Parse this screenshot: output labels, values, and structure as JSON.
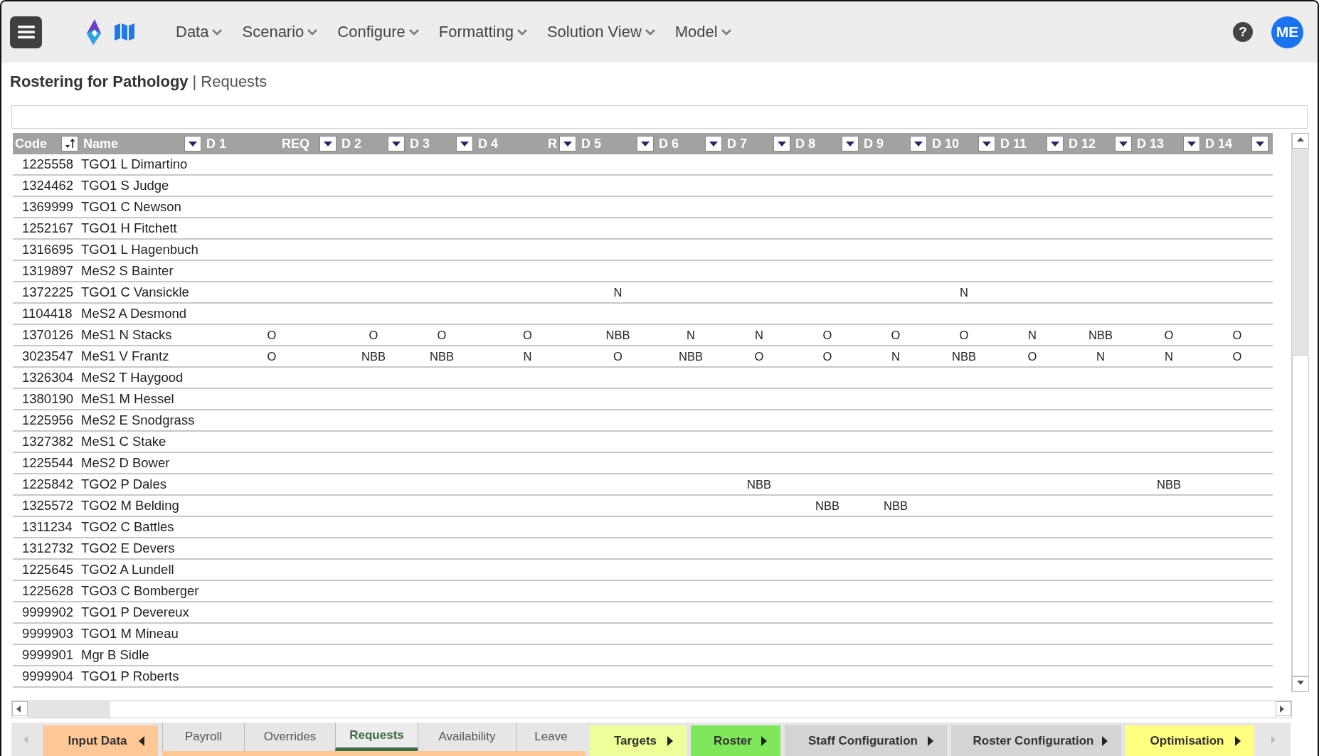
{
  "menu": [
    "Data",
    "Scenario",
    "Configure",
    "Formatting",
    "Solution View",
    "Model"
  ],
  "help": {
    "symbol": "?"
  },
  "user": {
    "initials": "ME"
  },
  "title": {
    "app": "Rostering for Pathology",
    "separator": "|",
    "page": "Requests"
  },
  "columns": [
    {
      "label": "Code",
      "kind": "sort"
    },
    {
      "label": "Name",
      "kind": "filter"
    },
    {
      "label": "D 1",
      "kind": "plain"
    },
    {
      "label": "REQ",
      "kind": "filter"
    },
    {
      "label": "D 2",
      "kind": "filter"
    },
    {
      "label": "D 3",
      "kind": "filter"
    },
    {
      "label": "D 4",
      "kind": "plain"
    },
    {
      "label": "R",
      "kind": "filter"
    },
    {
      "label": "D 5",
      "kind": "filter"
    },
    {
      "label": "D 6",
      "kind": "filter"
    },
    {
      "label": "D 7",
      "kind": "filter"
    },
    {
      "label": "D 8",
      "kind": "filter"
    },
    {
      "label": "D 9",
      "kind": "filter"
    },
    {
      "label": "D 10",
      "kind": "filter"
    },
    {
      "label": "D 11",
      "kind": "filter"
    },
    {
      "label": "D 12",
      "kind": "filter"
    },
    {
      "label": "D 13",
      "kind": "filter"
    },
    {
      "label": "D 14",
      "kind": "filter"
    }
  ],
  "rows": [
    {
      "code": "1225558",
      "name": "TGO1 L Dimartino",
      "days": {}
    },
    {
      "code": "1324462",
      "name": "TGO1 S Judge",
      "days": {}
    },
    {
      "code": "1369999",
      "name": "TGO1 C Newson",
      "days": {}
    },
    {
      "code": "1252167",
      "name": "TGO1 H Fitchett",
      "days": {}
    },
    {
      "code": "1316695",
      "name": "TGO1 L Hagenbuch",
      "days": {}
    },
    {
      "code": "1319897",
      "name": "MeS2 S Bainter",
      "days": {}
    },
    {
      "code": "1372225",
      "name": "TGO1 C Vansickle",
      "days": {
        "d5": "N",
        "d10": "N"
      }
    },
    {
      "code": "1104418",
      "name": "MeS2 A Desmond",
      "days": {}
    },
    {
      "code": "1370126",
      "name": "MeS1 N Stacks",
      "days": {
        "d1": "O",
        "d2": "O",
        "d3": "O",
        "d4": "O",
        "d5": "NBB",
        "d6": "N",
        "d7": "N",
        "d8": "O",
        "d9": "O",
        "d10": "O",
        "d11": "N",
        "d12": "NBB",
        "d13": "O",
        "d14": "O"
      }
    },
    {
      "code": "3023547",
      "name": "MeS1 V Frantz",
      "days": {
        "d1": "O",
        "d2": "NBB",
        "d3": "NBB",
        "d4": "N",
        "d5": "O",
        "d6": "NBB",
        "d7": "O",
        "d8": "O",
        "d9": "N",
        "d10": "NBB",
        "d11": "O",
        "d12": "N",
        "d13": "N",
        "d14": "O"
      }
    },
    {
      "code": "1326304",
      "name": "MeS2 T Haygood",
      "days": {}
    },
    {
      "code": "1380190",
      "name": "MeS1 M Hessel",
      "days": {}
    },
    {
      "code": "1225956",
      "name": "MeS2 E Snodgrass",
      "days": {}
    },
    {
      "code": "1327382",
      "name": "MeS1 C Stake",
      "days": {}
    },
    {
      "code": "1225544",
      "name": "MeS2 D Bower",
      "days": {}
    },
    {
      "code": "1225842",
      "name": "TGO2 P Dales",
      "days": {
        "d7": "NBB",
        "d13": "NBB"
      }
    },
    {
      "code": "1325572",
      "name": "TGO2 M Belding",
      "days": {
        "d8": "NBB",
        "d9": "NBB"
      }
    },
    {
      "code": "1311234",
      "name": "TGO2 C Battles",
      "days": {}
    },
    {
      "code": "1312732",
      "name": "TGO2 E Devers",
      "days": {}
    },
    {
      "code": "1225645",
      "name": "TGO2 A Lundell",
      "days": {}
    },
    {
      "code": "1225628",
      "name": "TGO3 C Bomberger",
      "days": {}
    },
    {
      "code": "9999902",
      "name": "TGO1 P Devereux",
      "days": {}
    },
    {
      "code": "9999903",
      "name": "TGO1 M Mineau",
      "days": {}
    },
    {
      "code": "9999901",
      "name": "Mgr B Sidle",
      "days": {}
    },
    {
      "code": "9999904",
      "name": "TGO1 P Roberts",
      "days": {}
    }
  ],
  "sheet_groups": [
    {
      "label": "Input Data",
      "color": "#ffc896",
      "expanded": true,
      "children": [
        {
          "label": "Payroll",
          "selected": false
        },
        {
          "label": "Overrides",
          "selected": false
        },
        {
          "label": "Requests",
          "selected": true
        },
        {
          "label": "Availability",
          "selected": false
        },
        {
          "label": "Leave",
          "selected": false
        }
      ]
    },
    {
      "label": "Targets",
      "color": "#eeff99",
      "expanded": false
    },
    {
      "label": "Roster",
      "color": "#7ee85a",
      "expanded": false
    },
    {
      "label": "Staff Configuration",
      "color": "#d4d4d4",
      "expanded": false
    },
    {
      "label": "Roster Configuration",
      "color": "#d4d4d4",
      "expanded": false
    },
    {
      "label": "Optimisation",
      "color": "#ffff80",
      "expanded": false
    }
  ]
}
